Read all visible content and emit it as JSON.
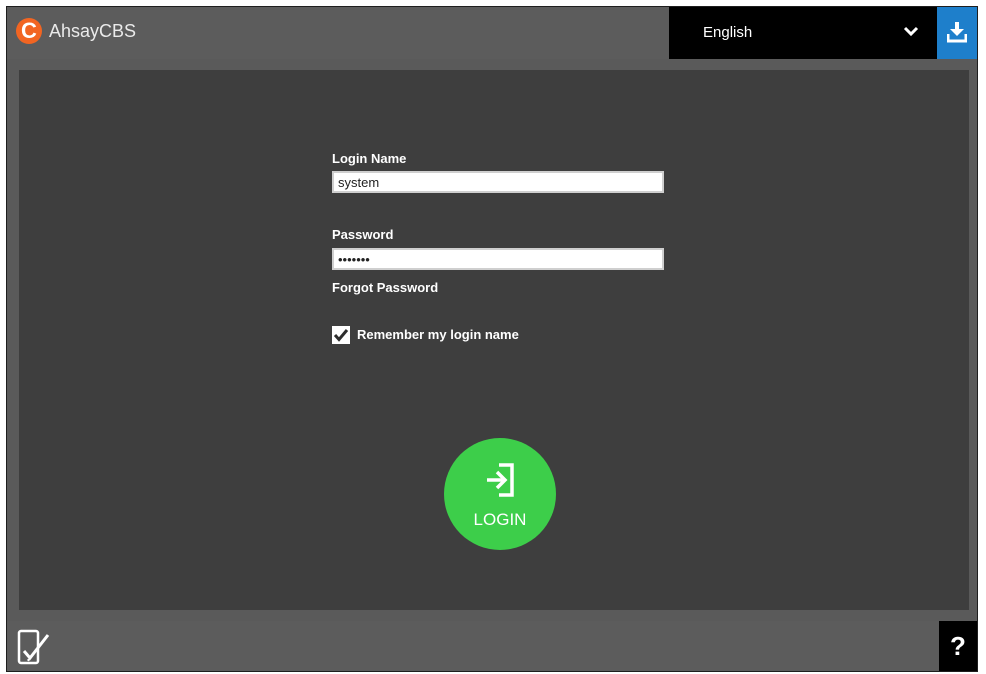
{
  "header": {
    "logo_letter": "C",
    "app_title": "AhsayCBS",
    "language": "English",
    "chevron_icon": "chevron-down-icon",
    "download_icon": "download-icon"
  },
  "login_form": {
    "login_name_label": "Login Name",
    "login_name_value": "system",
    "password_label": "Password",
    "password_value": "•••••••",
    "forgot_password": "Forgot Password",
    "remember_label": "Remember my login name",
    "remember_checked": true,
    "login_button_label": "LOGIN",
    "login_icon": "sign-in-icon"
  },
  "footer": {
    "device_icon": "mobile-check-icon",
    "help_label": "?"
  },
  "colors": {
    "brand_orange": "#f26522",
    "login_green": "#3dce4a",
    "download_blue": "#1e7fcb",
    "panel_bg": "#3e3e3e",
    "frame_bg": "#5c5c5c"
  }
}
